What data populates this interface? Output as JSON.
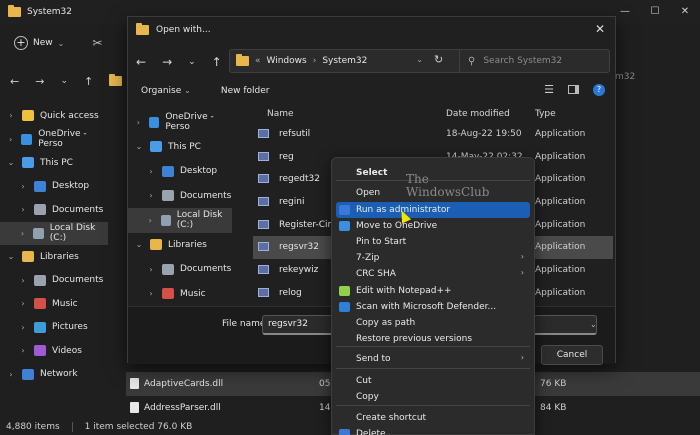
{
  "explorer": {
    "title": "System32",
    "new_label": "New",
    "search_fragment": "m32",
    "sidebar": [
      {
        "label": "Quick access",
        "chev": "›",
        "color": "#f0c23b"
      },
      {
        "label": "OneDrive - Perso",
        "chev": "›",
        "color": "#3a8fe0"
      },
      {
        "label": "This PC",
        "chev": "⌄",
        "color": "#4a9be8"
      },
      {
        "label": "Desktop",
        "chev": "›",
        "color": "#3e82d6"
      },
      {
        "label": "Documents",
        "chev": "›",
        "color": "#9aa3ad"
      },
      {
        "label": "Local Disk (C:)",
        "chev": "›",
        "color": "#8fa0b0"
      },
      {
        "label": "Libraries",
        "chev": "⌄",
        "color": "#e8b64a"
      },
      {
        "label": "Documents",
        "chev": "›",
        "color": "#9aa3ad"
      },
      {
        "label": "Music",
        "chev": "›",
        "color": "#d6504a"
      },
      {
        "label": "Pictures",
        "chev": "›",
        "color": "#3e9cd6"
      },
      {
        "label": "Videos",
        "chev": "›",
        "color": "#a05ad6"
      },
      {
        "label": "Network",
        "chev": "›",
        "color": "#3e82d6"
      }
    ],
    "files": [
      {
        "name": "AdaptiveCards.dll",
        "date": "05",
        "size": "76 KB"
      },
      {
        "name": "AddressParser.dll",
        "date": "14",
        "size": "84 KB"
      }
    ],
    "status": {
      "items": "4,880 items",
      "selected": "1 item selected  76.0 KB"
    }
  },
  "dialog": {
    "title": "Open with...",
    "breadcrumb": {
      "prefix": "«",
      "parts": [
        "Windows",
        "›",
        "System32"
      ]
    },
    "search_placeholder": "Search System32",
    "organise": "Organise",
    "new_folder": "New folder",
    "sidebar": [
      {
        "label": "OneDrive - Perso",
        "chev": "›",
        "color": "#3a8fe0"
      },
      {
        "label": "This PC",
        "chev": "⌄",
        "color": "#4a9be8"
      },
      {
        "label": "Desktop",
        "chev": "›",
        "color": "#3e82d6"
      },
      {
        "label": "Documents",
        "chev": "›",
        "color": "#9aa3ad"
      },
      {
        "label": "Local Disk (C:)",
        "chev": "›",
        "color": "#8fa0b0"
      },
      {
        "label": "Libraries",
        "chev": "⌄",
        "color": "#e8b64a"
      },
      {
        "label": "Documents",
        "chev": "›",
        "color": "#9aa3ad"
      },
      {
        "label": "Music",
        "chev": "›",
        "color": "#d6504a"
      }
    ],
    "columns": {
      "name": "Name",
      "date": "Date modified",
      "type": "Type"
    },
    "rows": [
      {
        "name": "refsutil",
        "date": "18-Aug-22 19:50",
        "type": "Application"
      },
      {
        "name": "reg",
        "date": "14-May-22 02:32",
        "type": "Application"
      },
      {
        "name": "regedt32",
        "date": "",
        "type": "Application"
      },
      {
        "name": "regini",
        "date": "",
        "type": "Application"
      },
      {
        "name": "Register-CimPr",
        "date": "",
        "type": "Application"
      },
      {
        "name": "regsvr32",
        "date": "",
        "type": "Application"
      },
      {
        "name": "rekeywiz",
        "date": "",
        "type": "Application"
      },
      {
        "name": "relog",
        "date": "",
        "type": "Application"
      }
    ],
    "filename_label": "File name:",
    "filename_value": "regsvr32",
    "cancel": "Cancel"
  },
  "context_menu": [
    {
      "label": "Select",
      "bold": true
    },
    {
      "label": "Open"
    },
    {
      "label": "Run as administrator",
      "highlight": true,
      "icon_color": "#3b78d8"
    },
    {
      "label": "Move to OneDrive",
      "icon_color": "#3a8fe0"
    },
    {
      "label": "Pin to Start"
    },
    {
      "label": "7-Zip",
      "arrow": "›"
    },
    {
      "label": "CRC SHA",
      "arrow": "›"
    },
    {
      "label": "Edit with Notepad++",
      "icon_color": "#8fd14f"
    },
    {
      "label": "Scan with Microsoft Defender...",
      "icon_color": "#2f7fd8"
    },
    {
      "label": "Copy as path"
    },
    {
      "label": "Restore previous versions"
    },
    {
      "label": "Send to",
      "arrow": "›"
    },
    {
      "label": "Cut"
    },
    {
      "label": "Copy"
    },
    {
      "label": "Create shortcut"
    },
    {
      "label": "Delete",
      "icon_color": "#3b78d8"
    }
  ],
  "watermark": {
    "line1": "The",
    "line2": "WindowsClub"
  }
}
